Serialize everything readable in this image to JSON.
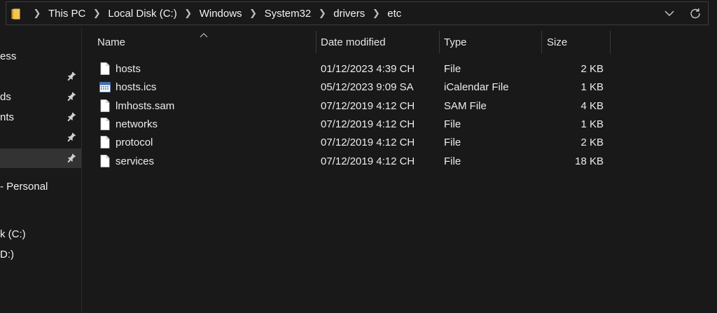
{
  "address": {
    "breadcrumbs": [
      "This PC",
      "Local Disk (C:)",
      "Windows",
      "System32",
      "drivers",
      "etc"
    ],
    "folder_icon": "folder-icon",
    "dropdown_icon": "chevron-down-icon",
    "refresh_icon": "refresh-icon"
  },
  "sidebar": {
    "items": [
      {
        "label": "ess",
        "pinned": false
      },
      {
        "label": "",
        "pinned": true
      },
      {
        "label": "ds",
        "pinned": true
      },
      {
        "label": "nts",
        "pinned": true
      },
      {
        "label": "",
        "pinned": true
      },
      {
        "label": "",
        "pinned": true,
        "selected": true
      },
      {
        "label": "- Personal",
        "pinned": false
      },
      {
        "label": "k (C:)",
        "pinned": false
      },
      {
        "label": "D:)",
        "pinned": false
      }
    ]
  },
  "columns": {
    "name": "Name",
    "date": "Date modified",
    "type": "Type",
    "size": "Size"
  },
  "files": [
    {
      "name": "hosts",
      "date": "01/12/2023 4:39 CH",
      "type": "File",
      "size": "2 KB",
      "icon": "file-icon"
    },
    {
      "name": "hosts.ics",
      "date": "05/12/2023 9:09 SA",
      "type": "iCalendar File",
      "size": "1 KB",
      "icon": "calendar-file-icon"
    },
    {
      "name": "lmhosts.sam",
      "date": "07/12/2019 4:12 CH",
      "type": "SAM File",
      "size": "4 KB",
      "icon": "file-icon"
    },
    {
      "name": "networks",
      "date": "07/12/2019 4:12 CH",
      "type": "File",
      "size": "1 KB",
      "icon": "file-icon"
    },
    {
      "name": "protocol",
      "date": "07/12/2019 4:12 CH",
      "type": "File",
      "size": "2 KB",
      "icon": "file-icon"
    },
    {
      "name": "services",
      "date": "07/12/2019 4:12 CH",
      "type": "File",
      "size": "18 KB",
      "icon": "file-icon"
    }
  ],
  "colors": {
    "background": "#191919",
    "selected": "#333333",
    "folder": "#e8b84a"
  }
}
